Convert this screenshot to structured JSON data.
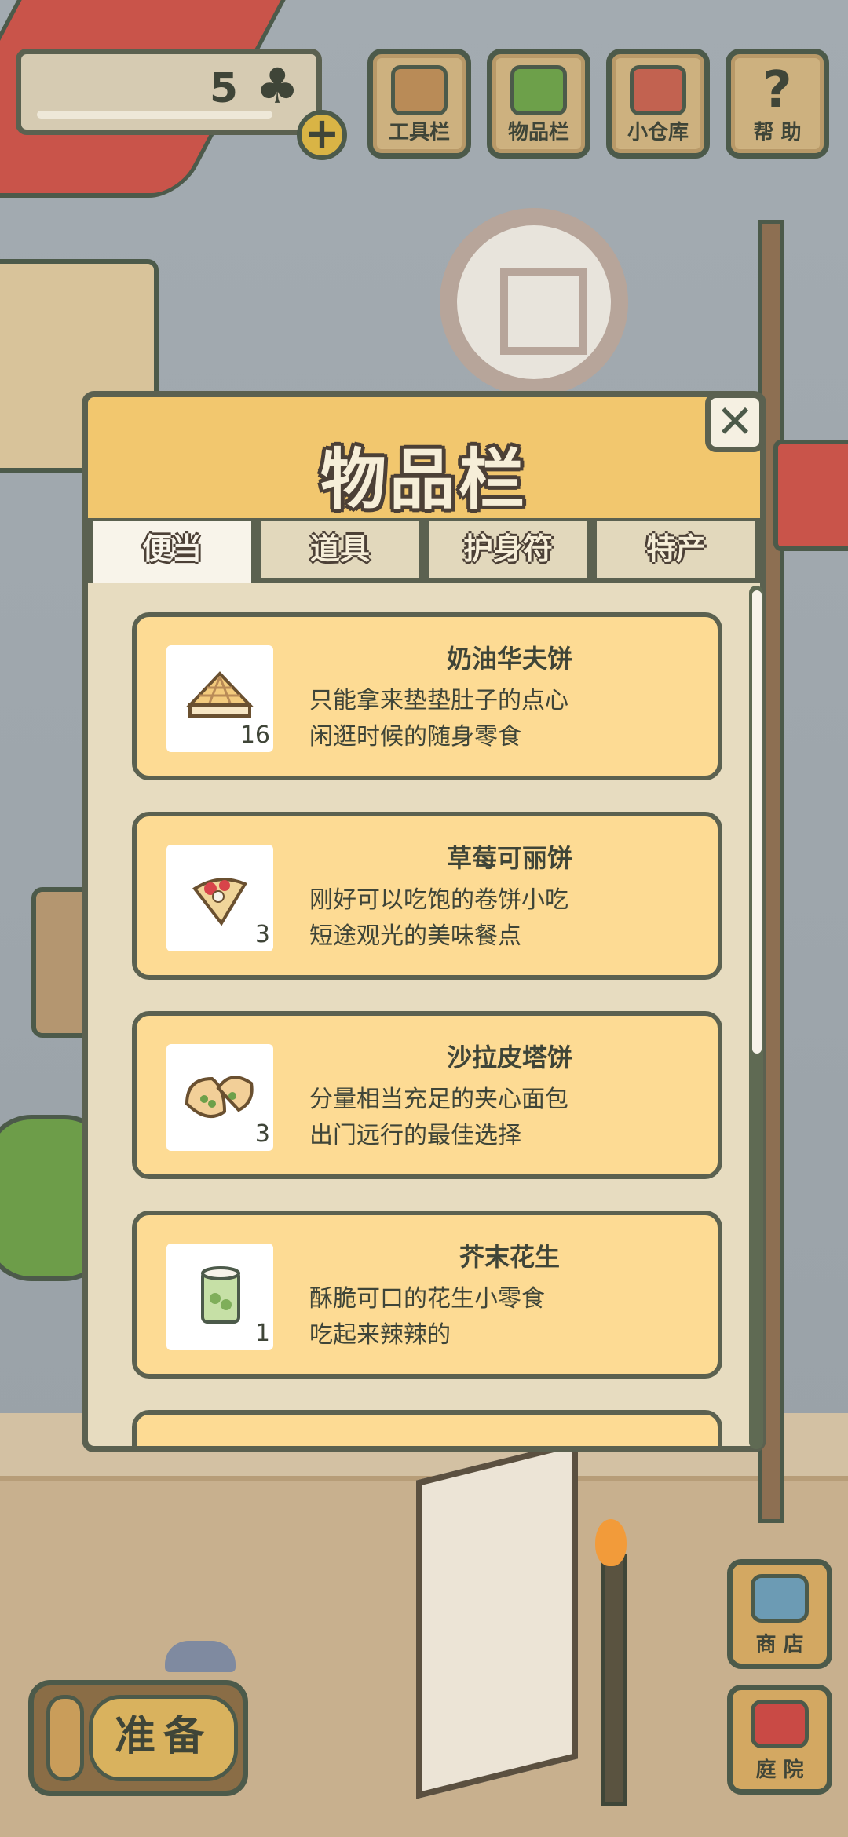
{
  "hud": {
    "clover_count": "5",
    "clover_icon": "clover-icon",
    "plus_label": "+",
    "buttons": [
      {
        "label": "工具栏",
        "icon": "toolbox-icon"
      },
      {
        "label": "物品栏",
        "icon": "bag-icon"
      },
      {
        "label": "小仓库",
        "icon": "storage-icon"
      },
      {
        "label": "帮 助",
        "icon": "help-icon",
        "glyph": "?"
      }
    ]
  },
  "dialog": {
    "title": "物品栏",
    "close_label": "✕",
    "tabs": [
      {
        "label": "便当",
        "active": true
      },
      {
        "label": "道具",
        "active": false
      },
      {
        "label": "护身符",
        "active": false
      },
      {
        "label": "特产",
        "active": false
      }
    ],
    "items": [
      {
        "name": "奶油华夫饼",
        "qty": "16",
        "desc1": "只能拿来垫垫肚子的点心",
        "desc2": "闲逛时候的随身零食",
        "icon": "waffle-icon"
      },
      {
        "name": "草莓可丽饼",
        "qty": "3",
        "desc1": "刚好可以吃饱的卷饼小吃",
        "desc2": "短途观光的美味餐点",
        "icon": "crepe-icon"
      },
      {
        "name": "沙拉皮塔饼",
        "qty": "3",
        "desc1": "分量相当充足的夹心面包",
        "desc2": "出门远行的最佳选择",
        "icon": "pita-icon"
      },
      {
        "name": "芥末花生",
        "qty": "1",
        "desc1": "酥脆可口的花生小零食",
        "desc2": "吃起来辣辣的",
        "icon": "peanut-can-icon"
      }
    ]
  },
  "bottom": {
    "prepare_label": "准备",
    "shop_label": "商 店",
    "yard_label": "庭 院"
  },
  "colors": {
    "outline": "#5b6150",
    "header": "#f2c76e",
    "card": "#fddb94",
    "panel": "#e7dcc0"
  }
}
